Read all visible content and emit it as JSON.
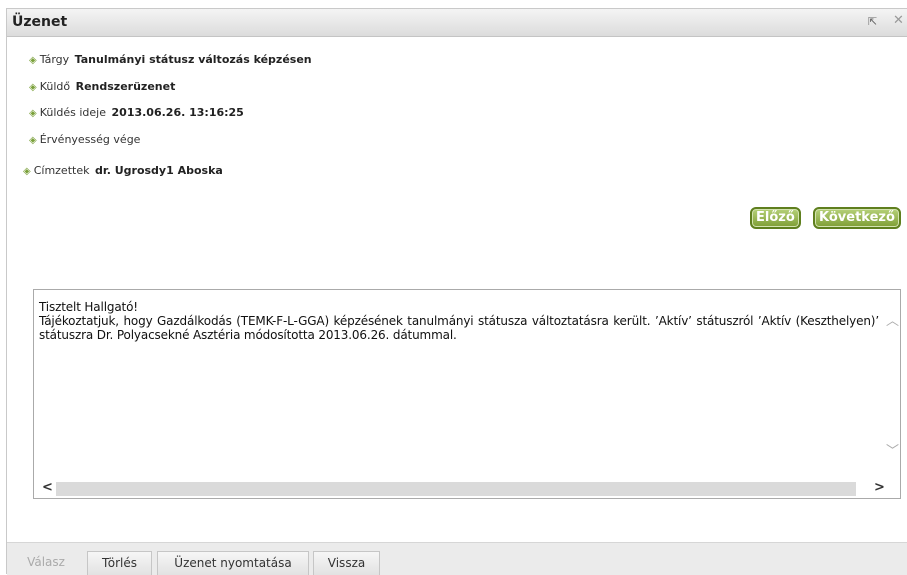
{
  "dialog": {
    "title": "Üzenet",
    "popout_icon": "popout-icon",
    "close_icon": "close-icon",
    "close_glyph": "✕"
  },
  "fields": {
    "subject": {
      "label": "Tárgy",
      "value": "Tanulmányi státusz változás képzésen"
    },
    "sender": {
      "label": "Küldő",
      "value": "Rendszerüzenet"
    },
    "sent_at": {
      "label": "Küldés ideje",
      "value": "2013.06.26. 13:16:25"
    },
    "expiry": {
      "label": "Érvényesség vége",
      "value": ""
    },
    "recipients": {
      "label": "Címzettek",
      "value": "dr. Ugrosdy1 Aboska"
    }
  },
  "nav": {
    "prev_label": "Előző",
    "next_label": "Következő"
  },
  "message": {
    "greeting": "Tisztelt Hallgató!",
    "body": "Tájékoztatjuk, hogy Gazdálkodás (TEMK-F-L-GGA) képzésének tanulmányi státusza változtatásra került. ’Aktív’ státuszról ’Aktív (Keszthelyen)’ státuszra Dr. Polyacsekné Asztéria módosította 2013.06.26. dátummal."
  },
  "scroll": {
    "up": "^",
    "down": "v",
    "left": "<",
    "right": ">"
  },
  "actions": {
    "reply": "Válasz",
    "delete": "Törlés",
    "print": "Üzenet nyomtatása",
    "back": "Vissza"
  },
  "colors": {
    "accent_green": "#7e9e34",
    "bullet_green": "#7aa03a"
  }
}
